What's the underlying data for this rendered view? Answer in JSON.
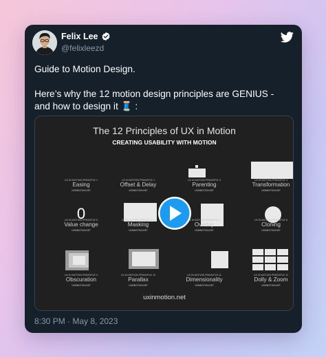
{
  "author": {
    "name": "Felix Lee",
    "handle": "@felixleezd"
  },
  "tweet": {
    "line1": "Guide to Motion Design.",
    "line2": "Here’s why the 12 motion design principles are GENIUS -",
    "line3": "and how to design it 🧵 :"
  },
  "media": {
    "title": "The 12 Principles of UX in Motion",
    "subtitle": "CREATING USABILITY WITH MOTION",
    "footer": "uxinmotion.net",
    "principles": [
      {
        "caption": "UX IN MOTION PRINCIPLE 1",
        "label": "Easing",
        "site": "UXINMOTION.NET"
      },
      {
        "caption": "UX IN MOTION PRINCIPLE 2",
        "label": "Offset & Delay",
        "site": "UXINMOTION.NET"
      },
      {
        "caption": "UX IN MOTION PRINCIPLE 3",
        "label": "Parenting",
        "site": "UXINMOTION.NET"
      },
      {
        "caption": "UX IN MOTION PRINCIPLE 4",
        "label": "Transformation",
        "site": "UXINMOTION.NET"
      },
      {
        "caption": "UX IN MOTION PRINCIPLE 5",
        "label": "Value change",
        "site": "UXINMOTION.NET"
      },
      {
        "caption": "UX IN MOTION PRINCIPLE 6",
        "label": "Masking",
        "site": "UXINMOTION.NET"
      },
      {
        "caption": "UX IN MOTION PRINCIPLE 7",
        "label": "Overlay",
        "site": "UXINMOTION.NET"
      },
      {
        "caption": "UX IN MOTION PRINCIPLE 8",
        "label": "Cloning",
        "site": "UXINMOTION.NET"
      },
      {
        "caption": "UX IN MOTION PRINCIPLE 9",
        "label": "Obscuration",
        "site": "UXINMOTION.NET"
      },
      {
        "caption": "UX IN MOTION PRINCIPLE 10",
        "label": "Parallax",
        "site": "UXINMOTION.NET"
      },
      {
        "caption": "UX IN MOTION PRINCIPLE 11",
        "label": "Dimensionality",
        "site": "UXINMOTION.NET"
      },
      {
        "caption": "UX IN MOTION PRINCIPLE 12",
        "label": "Dolly & Zoom",
        "site": "UXINMOTION.NET"
      }
    ],
    "value_digit": "0",
    "play_icon": "play-icon"
  },
  "timestamp": "8:30 PM · May 8, 2023",
  "colors": {
    "card_bg": "#15202b",
    "media_bg": "#202020",
    "play_button": "#1d9bf0",
    "verified": "#ffffff",
    "muted_text": "#8b98a5"
  }
}
